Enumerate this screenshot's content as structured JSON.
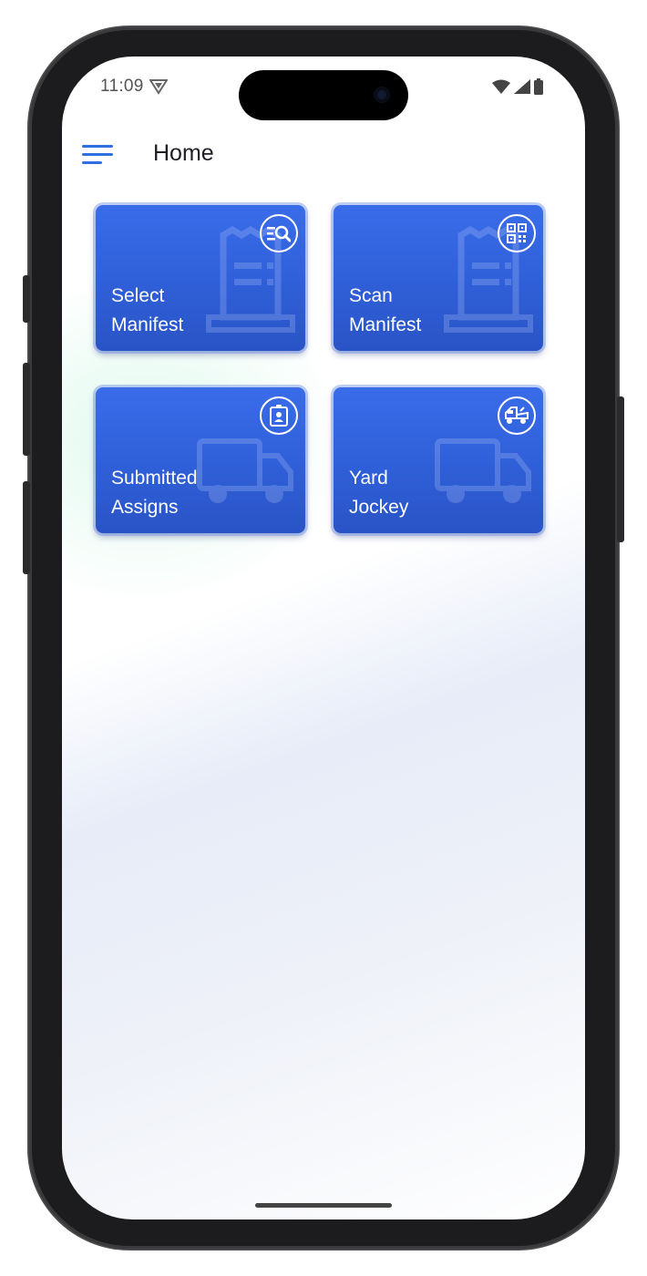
{
  "status_bar": {
    "time": "11:09",
    "left_icon": "shield-notification-icon",
    "right_icons": [
      "wifi-icon",
      "signal-icon",
      "battery-icon"
    ]
  },
  "header": {
    "title": "Home",
    "menu_icon": "hamburger-menu-icon"
  },
  "tiles": [
    {
      "line1": "Select",
      "line2": "Manifest",
      "badge_icon": "list-search-icon",
      "watermark_icon": "receipt-icon"
    },
    {
      "line1": "Scan",
      "line2": "Manifest",
      "badge_icon": "qr-code-icon",
      "watermark_icon": "receipt-icon"
    },
    {
      "line1": "Submitted",
      "line2": "Assigns",
      "badge_icon": "id-badge-icon",
      "watermark_icon": "truck-icon"
    },
    {
      "line1": "Yard",
      "line2": "Jockey",
      "badge_icon": "tow-truck-icon",
      "watermark_icon": "truck-icon"
    }
  ],
  "colors": {
    "tile_blue": "#2f5fd8",
    "menu_blue": "#2f6fe0",
    "title_text": "#1e1e24"
  }
}
